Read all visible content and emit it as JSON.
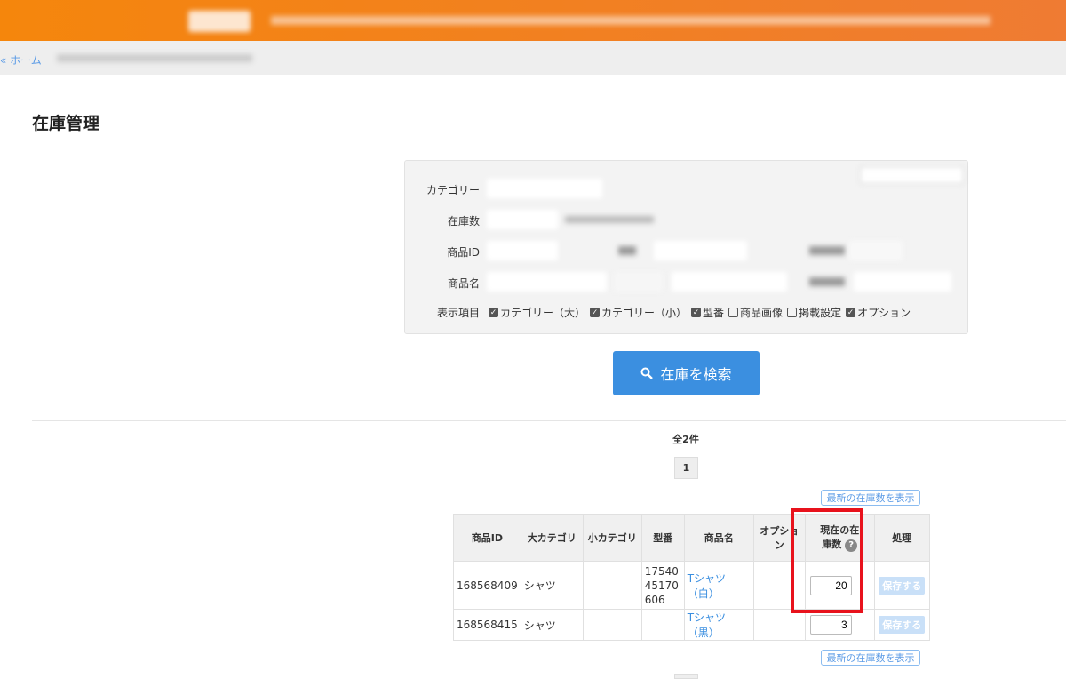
{
  "breadcrumb": {
    "home": "« ホーム"
  },
  "page_title": "在庫管理",
  "search": {
    "labels": {
      "category": "カテゴリー",
      "stock": "在庫数",
      "product_id": "商品ID",
      "product_name": "商品名",
      "display_items": "表示項目"
    },
    "display_options": [
      {
        "label": "カテゴリー（大）",
        "checked": true
      },
      {
        "label": "カテゴリー（小）",
        "checked": true
      },
      {
        "label": "型番",
        "checked": true
      },
      {
        "label": "商品画像",
        "checked": false
      },
      {
        "label": "掲載設定",
        "checked": false
      },
      {
        "label": "オプション",
        "checked": true
      }
    ],
    "button": "在庫を検索"
  },
  "results": {
    "total": "全2件",
    "page": "1",
    "refresh_label": "最新の在庫数を表示"
  },
  "table": {
    "headers": [
      "商品ID",
      "大カテゴリ",
      "小カテゴリ",
      "型番",
      "商品名",
      "オプション",
      "現在の在庫数",
      "処理"
    ],
    "help_icon": "?",
    "rows": [
      {
        "id": "168568409",
        "cat_l": "シャツ",
        "cat_s": "",
        "model": "1754045170606",
        "name": "Tシャツ（白）",
        "option": "",
        "stock": "20",
        "action": "保存する"
      },
      {
        "id": "168568415",
        "cat_l": "シャツ",
        "cat_s": "",
        "model": "",
        "name": "Tシャツ（黒）",
        "option": "",
        "stock": "3",
        "action": "保存する"
      }
    ]
  },
  "colors": {
    "banner": "#f5860c",
    "primary": "#3b8fe0",
    "highlight": "#e8121c"
  }
}
